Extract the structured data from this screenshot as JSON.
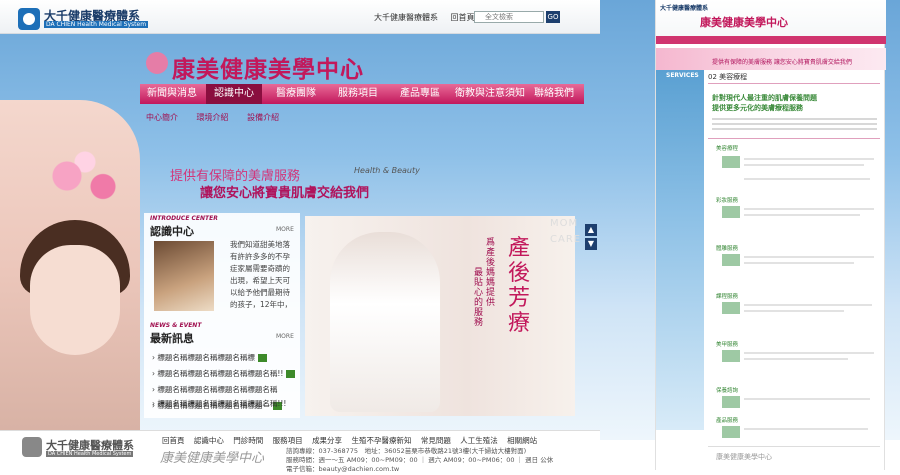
{
  "site": {
    "logo_cn": "大千健康醫療體系",
    "logo_en": "DA CHIEN Health Medical System",
    "brand": "康美健康美學中心",
    "top_links": [
      "大千健康醫療體系",
      "回首頁"
    ],
    "search_placeholder": "全文檢索",
    "search_button": "GO"
  },
  "nav": {
    "items": [
      "新聞與消息",
      "認識中心",
      "醫療團隊",
      "服務項目",
      "產品專區",
      "衛教與注意須知",
      "聯絡我們"
    ],
    "active_sub": "INTRODUCE"
  },
  "subnav": [
    "中心簡介",
    "環境介紹",
    "設備介紹"
  ],
  "slogan": {
    "line1": "提供有保障的美膚服務",
    "line2": "讓您安心將寶貴肌膚交給我們",
    "en": "Health & Beauty"
  },
  "about": {
    "title_en": "INTRODUCE CENTER",
    "title_cn": "認識中心",
    "more": "MORE",
    "text": "我們知道甜美地落有許許多多的不孕症家屬需要奇蹟的出現，希望上天可以給予他們最期待的孩子，12年中，"
  },
  "news": {
    "title_en": "NEWS & EVENT",
    "title_cn": "最新訊息",
    "more": "MORE",
    "items": [
      "標題名稱標題名稱標題名稱標",
      "標題名稱標題名稱標題名稱標題名稱!!",
      "標題名稱標題名稱標題名稱標題名稱",
      "標題名稱標題名稱標題名稱標題—",
      "標題名稱標題名稱標題名稱標題名稱!!!"
    ]
  },
  "hero": {
    "title": "產後芳療",
    "sub1": "爲產後媽媽提供",
    "sub2": "最貼心的服務",
    "en": "MOM CARE"
  },
  "footer": {
    "logo_cn": "大千健康醫療體系",
    "logo_en": "DA CHIEN Health Medical System",
    "links": [
      "回首頁",
      "認識中心",
      "門診時間",
      "服務項目",
      "成果分享",
      "生殖不孕醫療新知",
      "常見問題",
      "人工生殖法",
      "相關網站"
    ],
    "brand": "康美健康美學中心",
    "info1": "諮詢專線：037-368775　地址：36052苗栗市恭敬路21號3樓(大千婦幼大樓對面)",
    "info2": "服務時間：週一～五 AM09：00~PM09：00 ｜ 週六 AM09：00~PM06：00 ｜ 週日 公休",
    "info3": "電子信箱：beauty@dachien.com.tw"
  },
  "right": {
    "logo": "大千健康醫療體系",
    "brand": "康美健康美學中心",
    "banner": "提供有保障的美膚服務 讓您安心將寶貴肌膚交給我們",
    "services": "SERVICES",
    "page_head": "02 美容療程",
    "title1": "針對現代人最注重的肌膚保養問題",
    "title2": "提供更多元化的美膚療程服務",
    "sections": [
      "美容療程",
      "彩妝服務",
      "體雕服務",
      "課程服務",
      "美甲服務",
      "保養諮詢",
      "產品服務"
    ],
    "footer_brand": "康美健康美學中心"
  }
}
